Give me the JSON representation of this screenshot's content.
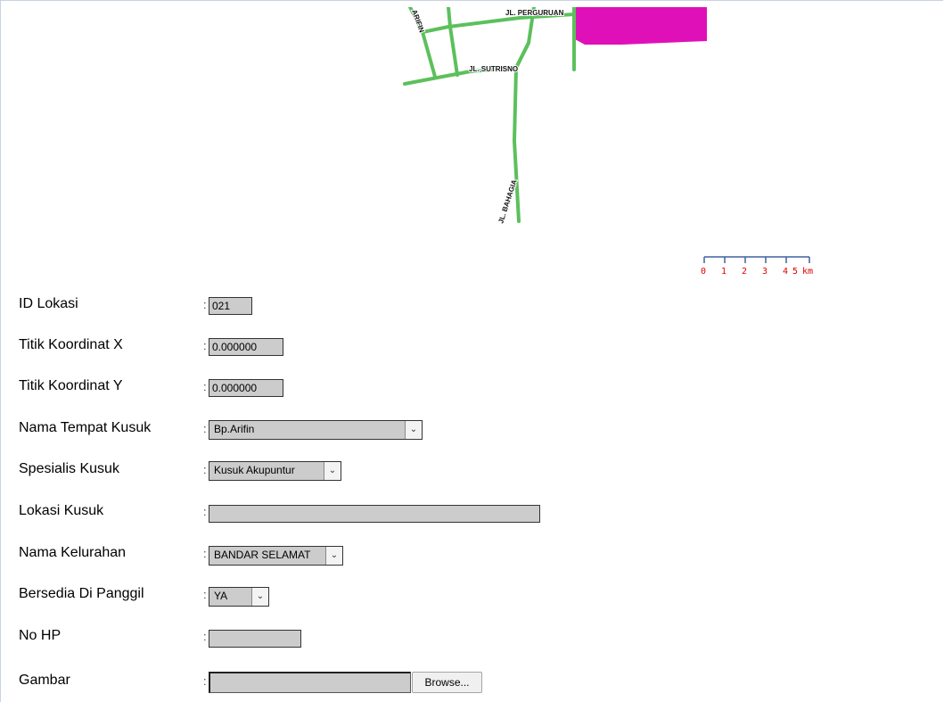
{
  "map": {
    "roads": {
      "perguruan": "JL. PERGURUAN",
      "sutrisno": "JL. SUTRISNO",
      "bahagia": "JL. BAHAGIA",
      "arifin": "ARIFIN"
    },
    "scale": {
      "ticks": [
        "0",
        "1",
        "2",
        "3",
        "4",
        "5"
      ],
      "unit": "km",
      "color": "#e00000"
    },
    "colors": {
      "road": "#5cc05c",
      "area": "#e010b8"
    }
  },
  "form": {
    "id_lokasi": {
      "label": "ID Lokasi",
      "value": "021"
    },
    "koordinat_x": {
      "label": "Titik Koordinat X",
      "value": "0.000000"
    },
    "koordinat_y": {
      "label": "Titik Koordinat Y",
      "value": "0.000000"
    },
    "nama_tempat": {
      "label": "Nama Tempat Kusuk",
      "selected": "Bp.Arifin"
    },
    "spesialis": {
      "label": "Spesialis Kusuk",
      "selected": "Kusuk Akupuntur"
    },
    "lokasi": {
      "label": "Lokasi Kusuk",
      "value": ""
    },
    "kelurahan": {
      "label": "Nama Kelurahan",
      "selected": "BANDAR SELAMAT"
    },
    "bersedia": {
      "label": "Bersedia Di Panggil",
      "selected": "YA"
    },
    "no_hp": {
      "label": "No HP",
      "value": ""
    },
    "gambar": {
      "label": "Gambar",
      "browse_label": "Browse..."
    },
    "colon": ":"
  }
}
